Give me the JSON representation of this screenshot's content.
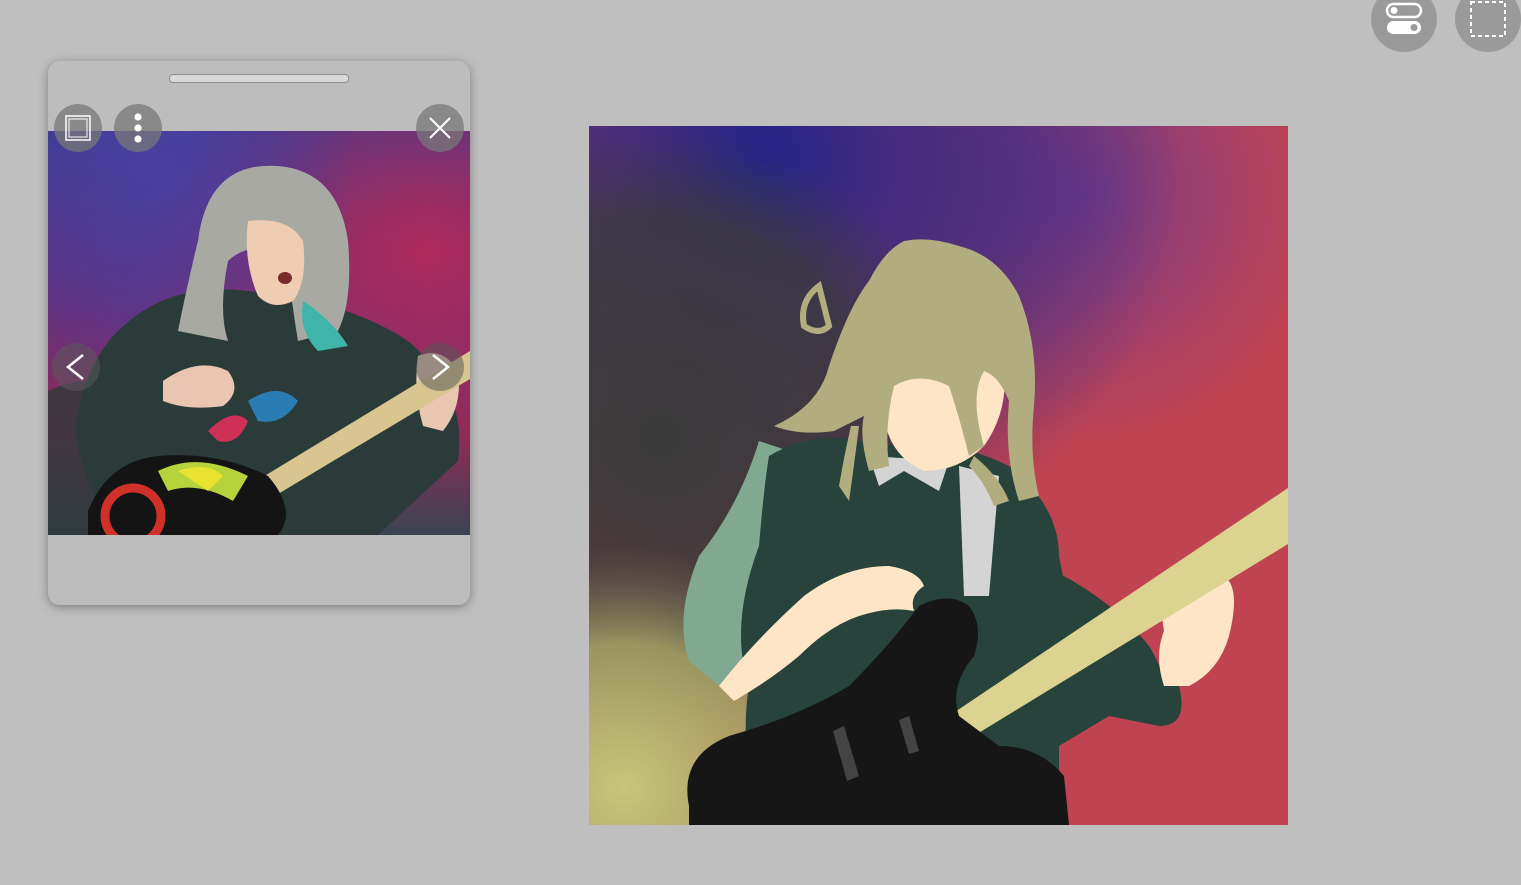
{
  "toolbar": {
    "buttons": [
      {
        "id": "toggles",
        "icon": "toggle-switches-icon"
      },
      {
        "id": "select",
        "icon": "dashed-selection-icon"
      }
    ]
  },
  "reference_panel": {
    "buttons": [
      {
        "id": "frame",
        "icon": "square-frame-icon"
      },
      {
        "id": "more",
        "icon": "vertical-dots-icon"
      },
      {
        "id": "close",
        "icon": "close-icon"
      },
      {
        "id": "prev",
        "icon": "chevron-left-icon"
      },
      {
        "id": "next",
        "icon": "chevron-right-icon"
      }
    ],
    "photo": {
      "subject": "guitarist-reference-photo"
    }
  },
  "canvas": {
    "subject": "guitarist-painting",
    "colors": {
      "hair": "#b2ad7e",
      "face": "#fde5c5",
      "shirt": "#27433c",
      "sleeve": "#81a890",
      "guitar_body": "#161616",
      "guitar_neck": "#dcd390",
      "collar": "#d4d4d4",
      "bg_blue": "#23238a",
      "bg_red": "#c04352",
      "bg_dark": "#3a3a3a",
      "bg_yellow": "#c5c77a"
    }
  }
}
